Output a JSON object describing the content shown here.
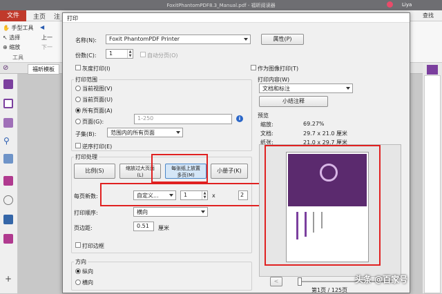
{
  "app": {
    "title": "FoxitPhantomPDF8.3_Manual.pdf - 福昕阅读器",
    "user": "Liya",
    "search_label": "查找",
    "file_tab": "文件",
    "tabs": [
      "主页",
      "注"
    ],
    "ribbon": {
      "hand_tool": "手型工具",
      "select": "选择",
      "zoom": "缩放",
      "group_label": "工具",
      "prev": "上一",
      "next": "下一"
    },
    "doc_tab": "福昕模板",
    "add_label": "+"
  },
  "dialog": {
    "title": "打印",
    "printer": {
      "name_label": "名称(N):",
      "value": "Foxit PhantomPDF Printer",
      "properties_button": "属性(P)"
    },
    "copies": {
      "label": "份数(C):",
      "value": "1",
      "collate_label": "自动分页(O)"
    },
    "grayscale_label": "灰度打印(I)",
    "print_as_image_label": "作为图像打印(T)",
    "range": {
      "title": "打印范围",
      "current_view": "当前视图(V)",
      "current_page": "当前页面(U)",
      "all_pages": "所有页面(A)",
      "pages": "页面(G):",
      "pages_placeholder": "1-250",
      "subset_label": "子集(B):",
      "subset_value": "范围内的所有页面",
      "reverse_label": "逆序打印(E)"
    },
    "handling": {
      "title": "打印处理",
      "scale": "比例(S)",
      "fit": "缩放过大页面(L)",
      "multiple": "每张纸上放置多页(M)",
      "booklet": "小册子(K)",
      "pages_per_sheet_label": "每页新数:",
      "pages_per_sheet_value": "自定义...",
      "cols": "1",
      "times": "x",
      "rows": "2",
      "order_label": "打印顺序:",
      "order_value": "横向",
      "margin_label": "页边距:",
      "margin_value": "0.51",
      "margin_unit": "厘米",
      "border_label": "打印边框"
    },
    "orientation": {
      "title": "方向",
      "portrait": "纵向",
      "landscape": "横向"
    },
    "content": {
      "title": "打印内容(W)",
      "value": "文档和标注",
      "summarize_button": "小结注释"
    },
    "preview": {
      "title": "预览",
      "zoom_label": "缩放:",
      "zoom_value": "69.27%",
      "doc_label": "文档:",
      "doc_value": "29.7 x 21.0 厘米",
      "paper_label": "纸张:",
      "paper_value": "21.0 x 29.7 厘米",
      "page_text": "第1页 / 125页",
      "prev_button": "<"
    }
  },
  "watermark": "头条 @百家号",
  "colors": {
    "accent_red": "#e02020",
    "purple": "#5b2a6e",
    "file_red": "#c0392b"
  }
}
